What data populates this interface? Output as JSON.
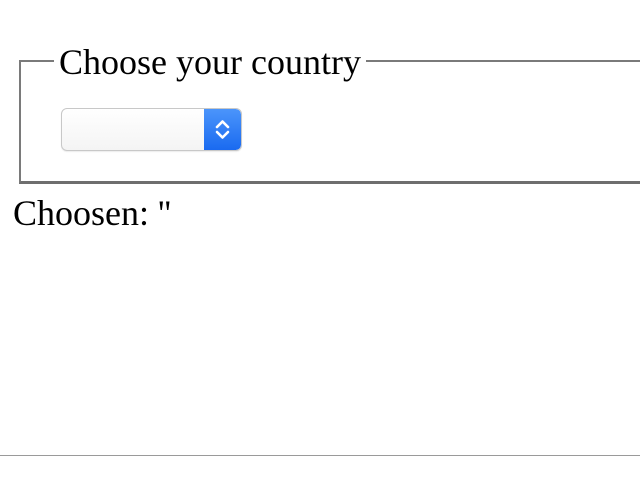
{
  "fieldset": {
    "legend": "Choose your country"
  },
  "country_select": {
    "selected_value": "",
    "icon": "chevron-up-down-icon",
    "accent_color": "#2f7ff7"
  },
  "result": {
    "text": "Choosen: ''"
  }
}
